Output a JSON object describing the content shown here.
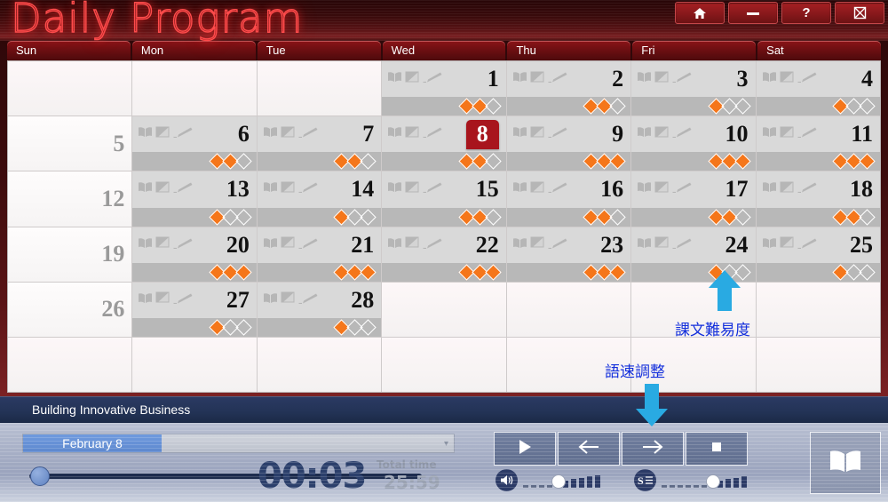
{
  "window": {
    "title": "Daily Program",
    "buttons": [
      {
        "name": "home-button",
        "icon": "home-icon"
      },
      {
        "name": "minimize-button",
        "icon": "minimize-icon"
      },
      {
        "name": "help-button",
        "icon": "question-icon",
        "label": "?"
      },
      {
        "name": "close-button",
        "icon": "close-icon"
      }
    ]
  },
  "calendar": {
    "weekday_headers": [
      "Sun",
      "Mon",
      "Tue",
      "Wed",
      "Thu",
      "Fri",
      "Sat"
    ],
    "today": 8,
    "cell_icons": [
      "book-icon",
      "image-icon",
      "pencil-icon"
    ],
    "weeks": [
      [
        {
          "type": "blank"
        },
        {
          "type": "blank"
        },
        {
          "type": "blank"
        },
        {
          "type": "day",
          "day": 1,
          "difficulty": 2
        },
        {
          "type": "day",
          "day": 2,
          "difficulty": 2
        },
        {
          "type": "day",
          "day": 3,
          "difficulty": 1
        },
        {
          "type": "day",
          "day": 4,
          "difficulty": 1
        }
      ],
      [
        {
          "type": "sun",
          "day": 5
        },
        {
          "type": "day",
          "day": 6,
          "difficulty": 2
        },
        {
          "type": "day",
          "day": 7,
          "difficulty": 2
        },
        {
          "type": "day",
          "day": 8,
          "difficulty": 2,
          "today": true
        },
        {
          "type": "day",
          "day": 9,
          "difficulty": 3
        },
        {
          "type": "day",
          "day": 10,
          "difficulty": 3
        },
        {
          "type": "day",
          "day": 11,
          "difficulty": 3
        }
      ],
      [
        {
          "type": "sun",
          "day": 12
        },
        {
          "type": "day",
          "day": 13,
          "difficulty": 1
        },
        {
          "type": "day",
          "day": 14,
          "difficulty": 1
        },
        {
          "type": "day",
          "day": 15,
          "difficulty": 2
        },
        {
          "type": "day",
          "day": 16,
          "difficulty": 2
        },
        {
          "type": "day",
          "day": 17,
          "difficulty": 2
        },
        {
          "type": "day",
          "day": 18,
          "difficulty": 2
        }
      ],
      [
        {
          "type": "sun",
          "day": 19
        },
        {
          "type": "day",
          "day": 20,
          "difficulty": 3
        },
        {
          "type": "day",
          "day": 21,
          "difficulty": 3
        },
        {
          "type": "day",
          "day": 22,
          "difficulty": 3
        },
        {
          "type": "day",
          "day": 23,
          "difficulty": 3
        },
        {
          "type": "day",
          "day": 24,
          "difficulty": 1
        },
        {
          "type": "day",
          "day": 25,
          "difficulty": 1
        }
      ],
      [
        {
          "type": "sun",
          "day": 26
        },
        {
          "type": "day",
          "day": 27,
          "difficulty": 1
        },
        {
          "type": "day",
          "day": 28,
          "difficulty": 1
        },
        {
          "type": "blank"
        },
        {
          "type": "blank"
        },
        {
          "type": "blank"
        },
        {
          "type": "blank"
        }
      ],
      [
        {
          "type": "blank"
        },
        {
          "type": "blank"
        },
        {
          "type": "blank"
        },
        {
          "type": "blank"
        },
        {
          "type": "blank"
        },
        {
          "type": "blank"
        },
        {
          "type": "blank"
        }
      ]
    ],
    "max_difficulty": 3
  },
  "annotations": [
    {
      "name": "difficulty-annotation",
      "text": "課文難易度",
      "color": "#1430dc"
    },
    {
      "name": "speed-annotation",
      "text": "語速調整",
      "color": "#1430dc"
    }
  ],
  "player": {
    "lesson_title": "Building Innovative Business",
    "date_select": {
      "value": "February 8",
      "caret": "chevron-down-icon"
    },
    "current_time": "00:03",
    "total_time_label": "Total time",
    "total_time": "25:59",
    "seek_position_pct": 2,
    "transport": [
      {
        "name": "play-button",
        "icon": "play-icon"
      },
      {
        "name": "previous-button",
        "icon": "arrow-left-icon"
      },
      {
        "name": "next-button",
        "icon": "arrow-right-icon"
      },
      {
        "name": "stop-button",
        "icon": "stop-icon"
      }
    ],
    "volume": {
      "name": "volume-slider",
      "icon": "speaker-icon",
      "level": 4,
      "steps": 10
    },
    "speed": {
      "name": "speed-slider",
      "icon": "speed-s-icon",
      "level": 6,
      "steps": 11
    },
    "book_button": {
      "name": "open-book-button",
      "icon": "open-book-icon"
    }
  },
  "colors": {
    "accent_red": "#a8151d",
    "diamond_on": "#f5761a",
    "annotation_blue": "#1430dc",
    "footer_navy": "#233356"
  }
}
